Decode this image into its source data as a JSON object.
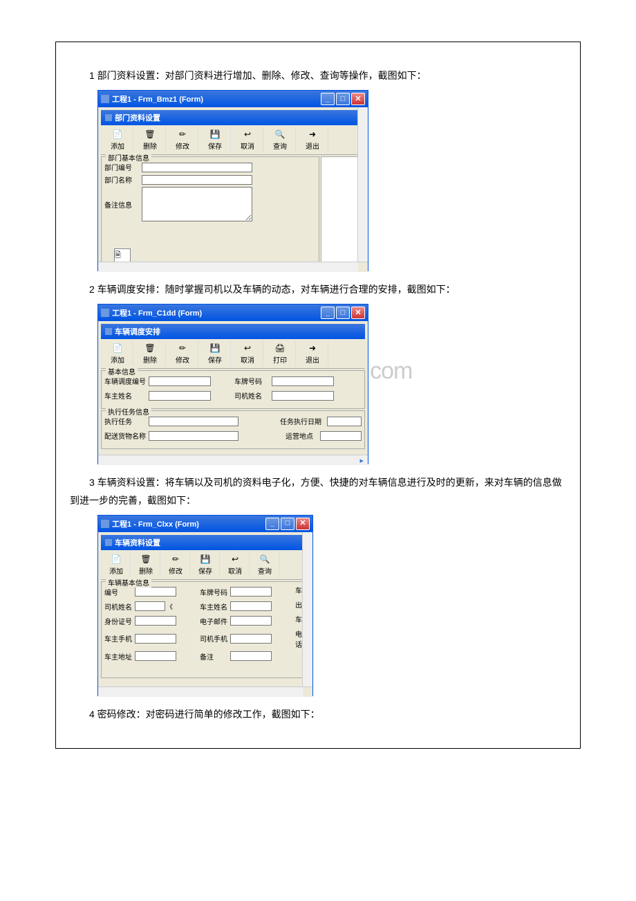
{
  "watermark": "www.bdocx.com",
  "section1": {
    "para": "1 部门资料设置：对部门资料进行增加、删除、修改、查询等操作，截图如下：",
    "win_title": "工程1 - Frm_Bmz1 (Form)",
    "sub_title": "部门资料设置",
    "toolbar": {
      "add": "添加",
      "del": "删除",
      "edit": "修改",
      "save": "保存",
      "cancel": "取消",
      "query": "查询",
      "exit": "退出"
    },
    "group_title": "部门基本信息",
    "fields": {
      "no": "部门编号",
      "name": "部门名称",
      "remark": "备注信息"
    }
  },
  "section2": {
    "para": "2 车辆调度安排：随时掌握司机以及车辆的动态，对车辆进行合理的安排，截图如下：",
    "win_title": "工程1 - Frm_C1dd (Form)",
    "sub_title": "车辆调度安排",
    "toolbar": {
      "add": "添加",
      "del": "删除",
      "edit": "修改",
      "save": "保存",
      "cancel": "取消",
      "print": "打印",
      "exit": "退出"
    },
    "group1_title": "基本信息",
    "group2_title": "执行任务信息",
    "fields": {
      "dispatch_no": "车辆调度编号",
      "plate": "车牌号码",
      "owner": "车主姓名",
      "driver": "司机姓名",
      "task": "执行任务",
      "task_date": "任务执行日期",
      "goods": "配送货物名称",
      "dest": "运营地点"
    }
  },
  "section3": {
    "para": "3 车辆资料设置：将车辆以及司机的资料电子化，方便、快捷的对车辆信息进行及时的更新，来对车辆的信息做到进一步的完善，截图如下：",
    "win_title": "工程1 - Frm_Clxx (Form)",
    "sub_title": "车辆资料设置",
    "toolbar": {
      "add": "添加",
      "del": "删除",
      "edit": "修改",
      "save": "保存",
      "cancel": "取消",
      "query": "查询"
    },
    "group_title": "车辆基本信息",
    "fields": {
      "no": "编号",
      "plate": "车牌号码",
      "driver": "司机姓名",
      "owner": "车主姓名",
      "idcard": "身份证号",
      "email": "电子邮件",
      "owner_phone": "车主手机",
      "driver_phone": "司机手机",
      "owner_addr": "车主地址",
      "remark": "备注"
    },
    "rlabels": {
      "car": "车",
      "out": "出",
      "car2": "车",
      "tel": "电话"
    }
  },
  "section4": {
    "para": "4 密码修改：对密码进行简单的修改工作，截图如下："
  },
  "icons": {
    "add": "📄",
    "del": "🗑",
    "edit": "✏",
    "save": "💾",
    "cancel": "↩",
    "query": "🔍",
    "print": "🖨",
    "exit": "➜"
  }
}
